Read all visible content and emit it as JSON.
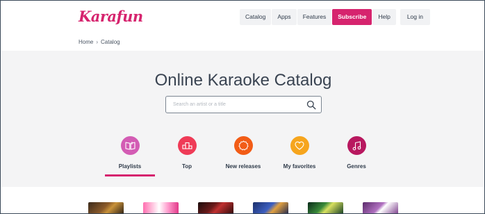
{
  "brand": {
    "name": "Karafun",
    "accent": "#d6246e"
  },
  "nav": {
    "items": [
      {
        "label": "Catalog"
      },
      {
        "label": "Apps"
      },
      {
        "label": "Features"
      },
      {
        "label": "Subscribe"
      },
      {
        "label": "Help"
      },
      {
        "label": "Log in"
      }
    ]
  },
  "breadcrumb": {
    "home": "Home",
    "separator": "›",
    "current": "Catalog"
  },
  "hero": {
    "title": "Online Karaoke Catalog",
    "search": {
      "placeholder": "Search an artist or a title",
      "value": ""
    }
  },
  "categories": [
    {
      "label": "Playlists",
      "icon": "book-icon",
      "color": "#d35cb4",
      "active": true
    },
    {
      "label": "Top",
      "icon": "podium-icon",
      "color": "#ef3b57",
      "active": false
    },
    {
      "label": "New releases",
      "icon": "badge-icon",
      "color": "#f25c16",
      "active": false
    },
    {
      "label": "My favorites",
      "icon": "heart-icon",
      "color": "#f6a51d",
      "active": false
    },
    {
      "label": "Genres",
      "icon": "music-note-icon",
      "color": "#b8185f",
      "active": false
    }
  ]
}
